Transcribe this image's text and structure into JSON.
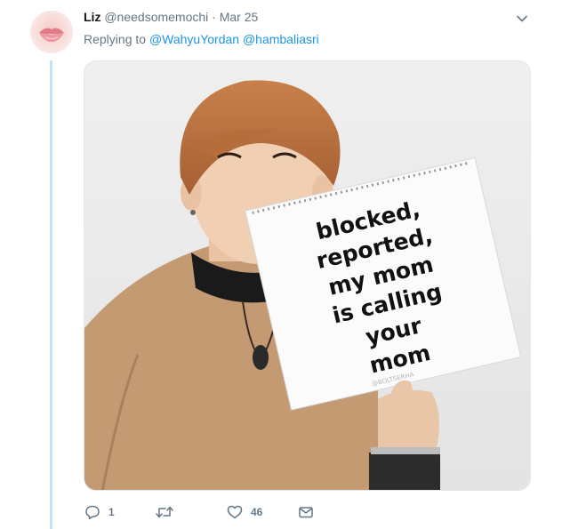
{
  "tweet": {
    "author_name": "Liz",
    "author_handle": "@needsomemochi",
    "separator": "·",
    "date": "Mar 25",
    "replying_to_label": "Replying to",
    "mentions": [
      "@WahyuYordan",
      "@hambaliasri"
    ],
    "caret_icon": "chevron-down-icon",
    "image_text": {
      "line1": "blocked,",
      "line2": "reported,",
      "line3": "my mom",
      "line4": "is calling",
      "line5": "your",
      "line6": "mom"
    },
    "watermark": "@BOLTSERHA"
  },
  "actions": {
    "reply": {
      "icon": "reply-icon",
      "count": "1"
    },
    "retweet": {
      "icon": "retweet-icon",
      "count": ""
    },
    "like": {
      "icon": "heart-icon",
      "count": "46"
    },
    "message": {
      "icon": "envelope-icon",
      "count": ""
    }
  },
  "colors": {
    "link": "#1b95e0",
    "secondary_text": "#657786",
    "thread_line": "#c4e2f5"
  }
}
